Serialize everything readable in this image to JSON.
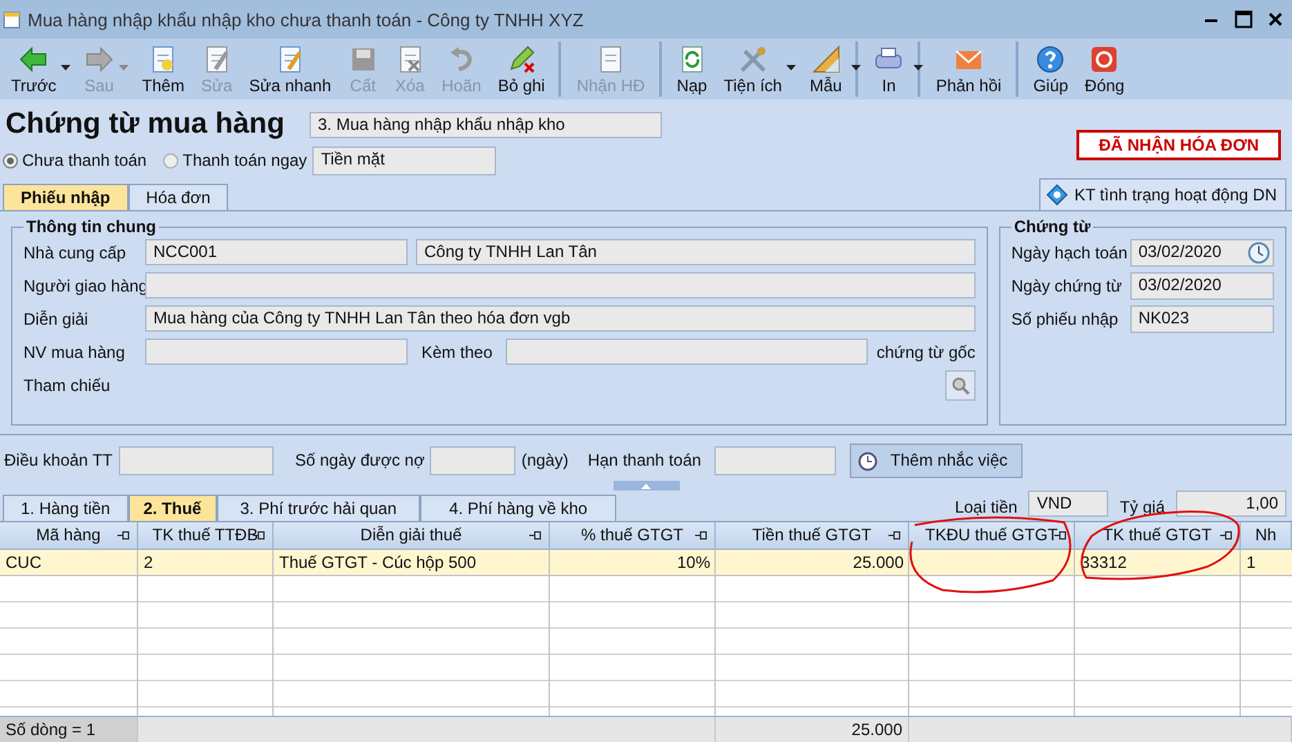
{
  "window": {
    "title": "Mua hàng nhập khẩu nhập kho chưa thanh toán - Công ty TNHH XYZ"
  },
  "toolbar": [
    {
      "label": "Trước",
      "disabled": false,
      "dropdown": true,
      "separator_after": false
    },
    {
      "label": "Sau",
      "disabled": true,
      "dropdown": true,
      "separator_after": false
    },
    {
      "label": "Thêm",
      "disabled": false,
      "dropdown": false,
      "separator_after": false
    },
    {
      "label": "Sửa",
      "disabled": true,
      "dropdown": false,
      "separator_after": false
    },
    {
      "label": "Sửa nhanh",
      "disabled": false,
      "dropdown": false,
      "separator_after": false
    },
    {
      "label": "Cất",
      "disabled": true,
      "dropdown": false,
      "separator_after": false
    },
    {
      "label": "Xóa",
      "disabled": true,
      "dropdown": false,
      "separator_after": false
    },
    {
      "label": "Hoãn",
      "disabled": true,
      "dropdown": false,
      "separator_after": false
    },
    {
      "label": "Bỏ ghi",
      "disabled": false,
      "dropdown": false,
      "separator_after": true
    },
    {
      "label": "Nhận HĐ",
      "disabled": true,
      "dropdown": false,
      "separator_after": true
    },
    {
      "label": "Nạp",
      "disabled": false,
      "dropdown": false,
      "separator_after": false
    },
    {
      "label": "Tiện ích",
      "disabled": false,
      "dropdown": true,
      "separator_after": false
    },
    {
      "label": "Mẫu",
      "disabled": false,
      "dropdown": true,
      "separator_after": true
    },
    {
      "label": "In",
      "disabled": false,
      "dropdown": true,
      "separator_after": true
    },
    {
      "label": "Phản hồi",
      "disabled": false,
      "dropdown": false,
      "separator_after": true
    },
    {
      "label": "Giúp",
      "disabled": false,
      "dropdown": false,
      "separator_after": false
    },
    {
      "label": "Đóng",
      "disabled": false,
      "dropdown": false,
      "separator_after": false
    }
  ],
  "form": {
    "heading": "Chứng từ mua hàng",
    "voucher_type": "3. Mua hàng nhập khẩu nhập kho",
    "payment_method": "Tiền mặt",
    "status_stamp": "ĐÃ NHẬN HÓA ĐƠN",
    "payment_options": [
      {
        "label": "Chưa thanh toán",
        "selected": true
      },
      {
        "label": "Thanh toán ngay",
        "selected": false
      }
    ]
  },
  "tabs": [
    {
      "label": "Phiếu nhập",
      "selected": true
    },
    {
      "label": "Hóa đơn",
      "selected": false
    }
  ],
  "check_button": "KT tình trạng hoạt động DN",
  "general": {
    "title": "Thông tin chung",
    "supplier_label": "Nhà cung cấp",
    "supplier_code": "NCC001",
    "supplier_name": "Công ty TNHH Lan Tân",
    "deliverer_label": "Người giao hàng",
    "description_label": "Diễn giải",
    "description": "Mua hàng của Công ty TNHH Lan Tân theo hóa đơn vgb",
    "buyer_label": "NV mua hàng",
    "attach_label": "Kèm theo",
    "attach_suffix": "chứng từ gốc",
    "reference_label": "Tham chiếu"
  },
  "voucher": {
    "title": "Chứng từ",
    "fields": [
      {
        "label": "Ngày hạch toán",
        "value": "03/02/2020",
        "kind": "date"
      },
      {
        "label": "Ngày chứng từ",
        "value": "03/02/2020",
        "kind": "text"
      },
      {
        "label": "Số phiếu nhập",
        "value": "NK023",
        "kind": "text"
      }
    ]
  },
  "terms": {
    "payment_terms_label": "Điều khoản TT",
    "days_label": "Số ngày được nợ",
    "days_unit": "(ngày)",
    "due_label": "Hạn thanh toán",
    "reminder_button": "Thêm nhắc việc"
  },
  "detail_tabs": [
    {
      "label": "1. Hàng tiền",
      "selected": false
    },
    {
      "label": "2. Thuế",
      "selected": true
    },
    {
      "label": "3. Phí trước hải quan",
      "selected": false
    },
    {
      "label": "4. Phí hàng về kho",
      "selected": false
    }
  ],
  "currency_label": "Loại tiền",
  "currency": "VND",
  "rate_label": "Tỷ giá",
  "rate": "1,00",
  "grid": {
    "columns": [
      {
        "label": "Mã hàng"
      },
      {
        "label": "TK thuế TTĐB"
      },
      {
        "label": "Diễn giải thuế"
      },
      {
        "label": "% thuế GTGT"
      },
      {
        "label": "Tiền thuế GTGT"
      },
      {
        "label": "TKĐU thuế GTGT"
      },
      {
        "label": "TK thuế GTGT"
      },
      {
        "label": "Nh"
      }
    ],
    "rows": [
      {
        "selected": true,
        "cells": [
          "CUC",
          "2",
          "Thuế GTGT - Cúc hộp 500",
          "10%",
          "25.000",
          "",
          "33312",
          "1"
        ]
      }
    ],
    "footer": {
      "count": "Số dòng = 1",
      "total": "25.000"
    }
  }
}
